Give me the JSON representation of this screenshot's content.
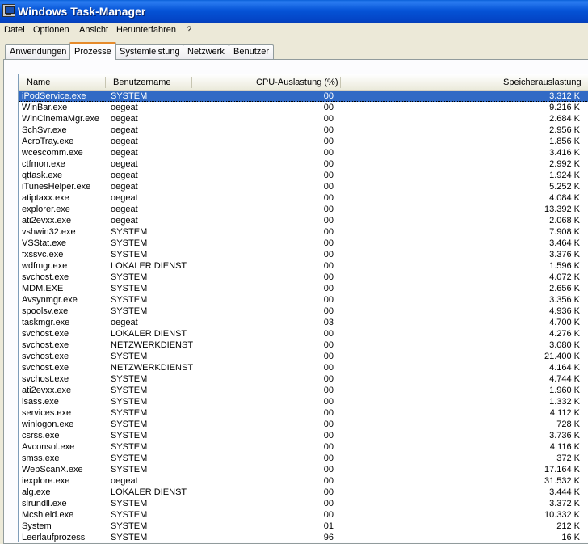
{
  "window": {
    "title": "Windows Task-Manager"
  },
  "menu": [
    "Datei",
    "Optionen",
    "Ansicht",
    "Herunterfahren",
    "?"
  ],
  "tabs": [
    "Anwendungen",
    "Prozesse",
    "Systemleistung",
    "Netzwerk",
    "Benutzer"
  ],
  "active_tab": "Prozesse",
  "columns": [
    "Name",
    "Benutzername",
    "CPU-Auslastung (%)",
    "Speicherauslastung"
  ],
  "processes": [
    [
      "iPodService.exe",
      "SYSTEM",
      "00",
      "3.312 K"
    ],
    [
      "WinBar.exe",
      "oegeat",
      "00",
      "9.216 K"
    ],
    [
      "WinCinemaMgr.exe",
      "oegeat",
      "00",
      "2.684 K"
    ],
    [
      "SchSvr.exe",
      "oegeat",
      "00",
      "2.956 K"
    ],
    [
      "AcroTray.exe",
      "oegeat",
      "00",
      "1.856 K"
    ],
    [
      "wcescomm.exe",
      "oegeat",
      "00",
      "3.416 K"
    ],
    [
      "ctfmon.exe",
      "oegeat",
      "00",
      "2.992 K"
    ],
    [
      "qttask.exe",
      "oegeat",
      "00",
      "1.924 K"
    ],
    [
      "iTunesHelper.exe",
      "oegeat",
      "00",
      "5.252 K"
    ],
    [
      "atiptaxx.exe",
      "oegeat",
      "00",
      "4.084 K"
    ],
    [
      "explorer.exe",
      "oegeat",
      "00",
      "13.392 K"
    ],
    [
      "ati2evxx.exe",
      "oegeat",
      "00",
      "2.068 K"
    ],
    [
      "vshwin32.exe",
      "SYSTEM",
      "00",
      "7.908 K"
    ],
    [
      "VSStat.exe",
      "SYSTEM",
      "00",
      "3.464 K"
    ],
    [
      "fxssvc.exe",
      "SYSTEM",
      "00",
      "3.376 K"
    ],
    [
      "wdfmgr.exe",
      "LOKALER DIENST",
      "00",
      "1.596 K"
    ],
    [
      "svchost.exe",
      "SYSTEM",
      "00",
      "4.072 K"
    ],
    [
      "MDM.EXE",
      "SYSTEM",
      "00",
      "2.656 K"
    ],
    [
      "Avsynmgr.exe",
      "SYSTEM",
      "00",
      "3.356 K"
    ],
    [
      "spoolsv.exe",
      "SYSTEM",
      "00",
      "4.936 K"
    ],
    [
      "taskmgr.exe",
      "oegeat",
      "03",
      "4.700 K"
    ],
    [
      "svchost.exe",
      "LOKALER DIENST",
      "00",
      "4.276 K"
    ],
    [
      "svchost.exe",
      "NETZWERKDIENST",
      "00",
      "3.080 K"
    ],
    [
      "svchost.exe",
      "SYSTEM",
      "00",
      "21.400 K"
    ],
    [
      "svchost.exe",
      "NETZWERKDIENST",
      "00",
      "4.164 K"
    ],
    [
      "svchost.exe",
      "SYSTEM",
      "00",
      "4.744 K"
    ],
    [
      "ati2evxx.exe",
      "SYSTEM",
      "00",
      "1.960 K"
    ],
    [
      "lsass.exe",
      "SYSTEM",
      "00",
      "1.332 K"
    ],
    [
      "services.exe",
      "SYSTEM",
      "00",
      "4.112 K"
    ],
    [
      "winlogon.exe",
      "SYSTEM",
      "00",
      "728 K"
    ],
    [
      "csrss.exe",
      "SYSTEM",
      "00",
      "3.736 K"
    ],
    [
      "Avconsol.exe",
      "SYSTEM",
      "00",
      "4.116 K"
    ],
    [
      "smss.exe",
      "SYSTEM",
      "00",
      "372 K"
    ],
    [
      "WebScanX.exe",
      "SYSTEM",
      "00",
      "17.164 K"
    ],
    [
      "iexplore.exe",
      "oegeat",
      "00",
      "31.532 K"
    ],
    [
      "alg.exe",
      "LOKALER DIENST",
      "00",
      "3.444 K"
    ],
    [
      "slrundll.exe",
      "SYSTEM",
      "00",
      "3.372 K"
    ],
    [
      "Mcshield.exe",
      "SYSTEM",
      "00",
      "10.332 K"
    ],
    [
      "System",
      "SYSTEM",
      "01",
      "212 K"
    ],
    [
      "Leerlaufprozess",
      "SYSTEM",
      "96",
      "16 K"
    ]
  ],
  "selected_row": 0,
  "colors": {
    "title_bar": "#0553d6",
    "selection": "#316ac5",
    "active_tab_accent": "#e68b2c"
  }
}
